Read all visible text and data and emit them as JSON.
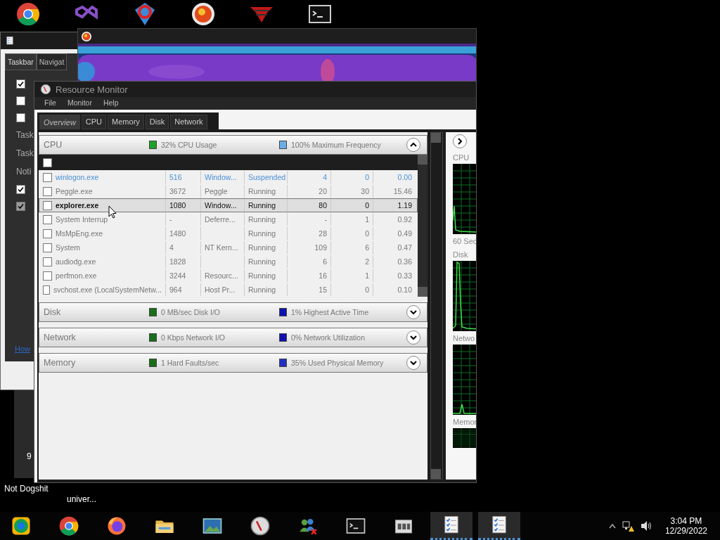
{
  "desktop_icons": [
    {
      "kind": "chrome"
    },
    {
      "kind": "studio"
    },
    {
      "kind": "ring"
    },
    {
      "kind": "peggle"
    },
    {
      "kind": "eagle"
    },
    {
      "kind": "terminal"
    }
  ],
  "desktop_labels": [
    {
      "text": "Not Dogshit"
    },
    {
      "text": "univer..."
    }
  ],
  "desktop_badge": "9",
  "back_window": {
    "tabs": [
      {
        "label": "Taskbar",
        "selected": true
      },
      {
        "label": "Navigat",
        "selected": false
      }
    ],
    "options": [
      {
        "kind": "checkbox",
        "checked": true,
        "disabled": false
      },
      {
        "kind": "checkbox",
        "checked": false,
        "disabled": false
      },
      {
        "kind": "checkbox",
        "checked": false,
        "disabled": false
      },
      {
        "kind": "label",
        "label": "Task"
      },
      {
        "kind": "label",
        "label": "Task"
      },
      {
        "kind": "label",
        "label": "Noti"
      },
      {
        "kind": "checkbox",
        "checked": true,
        "disabled": false
      },
      {
        "kind": "checkbox",
        "checked": true,
        "disabled": true
      }
    ],
    "link": "How"
  },
  "window": {
    "title": "Resource Monitor",
    "menu": [
      "File",
      "Monitor",
      "Help"
    ],
    "tabs": [
      {
        "label": "Overview",
        "selected": true
      },
      {
        "label": "CPU",
        "selected": false
      },
      {
        "label": "Memory",
        "selected": false
      },
      {
        "label": "Disk",
        "selected": false
      },
      {
        "label": "Network",
        "selected": false
      }
    ],
    "sections": [
      {
        "title": "CPU",
        "expanded": true,
        "legends": [
          {
            "text": "32% CPU Usage",
            "color": "#1fa02a"
          },
          {
            "text": "100% Maximum Frequency",
            "color": "#6aaee8"
          }
        ]
      },
      {
        "title": "Disk",
        "expanded": false,
        "legends": [
          {
            "text": "0 MB/sec Disk I/O",
            "color": "#1a6e1a"
          },
          {
            "text": "1% Highest Active Time",
            "color": "#1010b0"
          }
        ]
      },
      {
        "title": "Network",
        "expanded": false,
        "legends": [
          {
            "text": "0 Kbps Network I/O",
            "color": "#1a6e1a"
          },
          {
            "text": "0% Network Utilization",
            "color": "#1010b0"
          }
        ]
      },
      {
        "title": "Memory",
        "expanded": false,
        "legends": [
          {
            "text": "1 Hard Faults/sec",
            "color": "#1a6e1a"
          },
          {
            "text": "35% Used Physical Memory",
            "color": "#2030c0"
          }
        ]
      }
    ],
    "table": {
      "header_checked": false,
      "rows": [
        {
          "column_1": "winlogon.exe",
          "column_2": "516",
          "column_3": "Window...",
          "column_4": "Suspended",
          "column_5": "4",
          "column_6": "0",
          "column_7": "0.00",
          "kind": "suspended",
          "selected": false,
          "checked": false
        },
        {
          "column_1": "Peggle.exe",
          "column_2": "3672",
          "column_3": "Peggle",
          "column_4": "Running",
          "column_5": "20",
          "column_6": "30",
          "column_7": "15.46",
          "kind": "normal",
          "selected": false,
          "checked": false
        },
        {
          "column_1": "explorer.exe",
          "column_2": "1080",
          "column_3": "Window...",
          "column_4": "Running",
          "column_5": "80",
          "column_6": "0",
          "column_7": "1.19",
          "kind": "normal",
          "selected": true,
          "checked": false
        },
        {
          "column_1": "System Interrup",
          "column_2": "-",
          "column_3": "Deferre...",
          "column_4": "Running",
          "column_5": "-",
          "column_6": "1",
          "column_7": "0.92",
          "kind": "normal",
          "selected": false,
          "checked": false
        },
        {
          "column_1": "MsMpEng.exe",
          "column_2": "1480",
          "column_4": "Running",
          "column_5": "28",
          "column_6": "0",
          "column_7": "0.49",
          "kind": "normal",
          "selected": false,
          "checked": false
        },
        {
          "column_1": "System",
          "column_2": "4",
          "column_3": "NT Kern...",
          "column_4": "Running",
          "column_5": "109",
          "column_6": "6",
          "column_7": "0.47",
          "kind": "normal",
          "selected": false,
          "checked": false
        },
        {
          "column_1": "audiodg.exe",
          "column_2": "1828",
          "column_4": "Running",
          "column_5": "6",
          "column_6": "2",
          "column_7": "0.36",
          "kind": "normal",
          "selected": false,
          "checked": false
        },
        {
          "column_1": "perfmon.exe",
          "column_2": "3244",
          "column_3": "Resourc...",
          "column_4": "Running",
          "column_5": "16",
          "column_6": "1",
          "column_7": "0.33",
          "kind": "normal",
          "selected": false,
          "checked": false
        },
        {
          "column_1": "svchost.exe (LocalSystemNetw...",
          "column_2": "964",
          "column_3": "Host Pr...",
          "column_4": "Running",
          "column_5": "15",
          "column_6": "0",
          "column_7": "0.10",
          "kind": "normal",
          "selected": false,
          "checked": false
        }
      ]
    },
    "graphs": [
      {
        "label": "CPU",
        "caption": "60 Sec"
      },
      {
        "label": "Disk"
      },
      {
        "label": "Netwo"
      },
      {
        "label": "Memor"
      }
    ]
  },
  "taskbar": {
    "buttons": [
      {
        "kind": "canary",
        "open": false
      },
      {
        "kind": "chrome",
        "open": false
      },
      {
        "kind": "firefox",
        "open": false
      },
      {
        "kind": "folder",
        "open": false
      },
      {
        "kind": "photos",
        "open": false
      },
      {
        "kind": "gauge",
        "open": false
      },
      {
        "kind": "messenger",
        "open": false
      },
      {
        "kind": "terminal",
        "open": false
      },
      {
        "kind": "archive",
        "open": false
      },
      {
        "kind": "checklist",
        "open": true
      },
      {
        "kind": "checklist",
        "open": true
      }
    ],
    "time": "3:04 PM",
    "date": "12/29/2022"
  }
}
